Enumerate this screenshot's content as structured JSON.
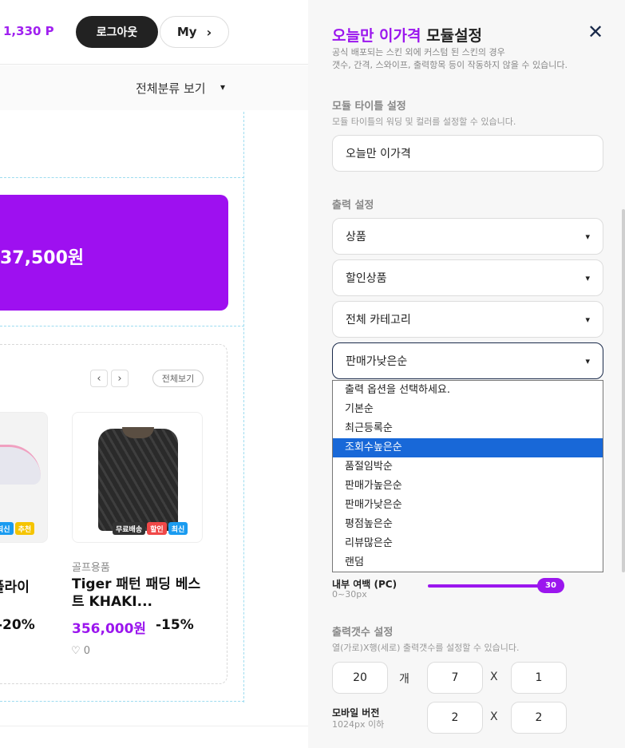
{
  "header": {
    "points": "1,330 P",
    "logout_label": "로그아웃",
    "my_label": "My",
    "category_toggle": "전체분류 보기"
  },
  "promo": {
    "price": "37,500원"
  },
  "product_card": {
    "view_all": "전체보기",
    "prev": "‹",
    "next": "›",
    "item1": {
      "badges": [
        "최신",
        "추천"
      ],
      "name": "플라이",
      "discount": "-20%"
    },
    "item2": {
      "badges": [
        "무료배송",
        "할인",
        "최신"
      ],
      "category": "골프용품",
      "name": "Tiger 패턴 패딩 베스트 KHAKI...",
      "price": "356,000원",
      "discount": "-15%",
      "likes": "0"
    }
  },
  "panel": {
    "title_accent": "오늘만 이가격",
    "title_rest": " 모듈설정",
    "desc_line1": "공식 배포되는 스킨 외에 커스텀 된 스킨의 경우",
    "desc_line2": "갯수, 간격, 스와이프, 출력항목 등이 작동하지 않을 수 있습니다.",
    "module_title": {
      "heading": "모듈 타이틀 설정",
      "sub": "모듈 타이틀의 워딩 및 컬러를 설정할 수 있습니다.",
      "value": "오늘만 이가격"
    },
    "output": {
      "heading": "출력 설정",
      "select1": "상품",
      "select2": "할인상품",
      "select3": "전체 카테고리",
      "select4": "판매가낮은순",
      "options": [
        "출력 옵션을 선택하세요.",
        "기본순",
        "최근등록순",
        "조회수높은순",
        "품절임박순",
        "판매가높은순",
        "판매가낮은순",
        "평점높은순",
        "리뷰많은순",
        "랜덤"
      ],
      "highlighted_option": "조회수높은순"
    },
    "padding": {
      "label": "내부 여백 (PC)",
      "range": "0~30px",
      "value": "30"
    },
    "count": {
      "heading": "출력갯수 설정",
      "sub": "열(가로)X행(세로) 출력갯수를 설정할 수 있습니다.",
      "total": "20",
      "unit": "개",
      "pc_cols": "7",
      "pc_rows": "1",
      "times": "X",
      "mobile_label": "모바일 버전",
      "mobile_sub": "1024px 이하",
      "mobile_cols": "2",
      "mobile_rows": "2"
    }
  },
  "colors": {
    "accent": "#9b16ee",
    "selection": "#1868d8",
    "badge_free": "#333333",
    "badge_sale": "#f04848",
    "badge_new": "#1a9bf0",
    "badge_rec": "#f5c400"
  }
}
